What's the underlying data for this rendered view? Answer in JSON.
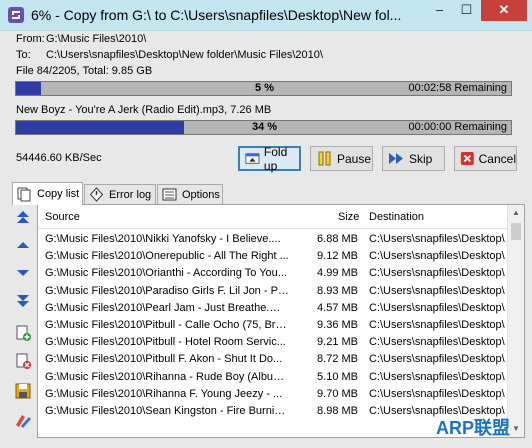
{
  "window": {
    "title": "6% - Copy from G:\\ to C:\\Users\\snapfiles\\Desktop\\New fol...",
    "controls": {
      "minimize": "–",
      "maximize": "☐",
      "close": "✕"
    }
  },
  "info": {
    "from_label": "From:",
    "from_value": "G:\\Music Files\\2010\\",
    "to_label": "To:",
    "to_value": "C:\\Users\\snapfiles\\Desktop\\New folder\\Music Files\\2010\\",
    "file_count": "File 84/2205, Total: 9.85 GB"
  },
  "overall_progress": {
    "fraction": 0.05,
    "percent_label": "5 %",
    "remaining": "00:02:58 Remaining"
  },
  "current_file": "New Boyz - You're A Jerk (Radio Edit).mp3, 7.26 MB",
  "file_progress": {
    "fraction": 0.34,
    "percent_label": "34 %",
    "remaining": "00:00:00 Remaining"
  },
  "speed": "54446.60 KB/Sec",
  "buttons": {
    "fold_up": "Fold up",
    "pause": "Pause",
    "skip": "Skip",
    "cancel": "Cancel"
  },
  "tabs": {
    "copy_list": "Copy list",
    "error_log": "Error log",
    "options": "Options"
  },
  "columns": {
    "source": "Source",
    "size": "Size",
    "destination": "Destination"
  },
  "rows": [
    {
      "source": "G:\\Music Files\\2010\\Nikki Yanofsky - I Believe....",
      "size": "6.88 MB",
      "dest": "C:\\Users\\snapfiles\\Desktop\\"
    },
    {
      "source": "G:\\Music Files\\2010\\Onerepublic - All The Right ...",
      "size": "9.12 MB",
      "dest": "C:\\Users\\snapfiles\\Desktop\\"
    },
    {
      "source": "G:\\Music Files\\2010\\Orianthi - According To You...",
      "size": "4.99 MB",
      "dest": "C:\\Users\\snapfiles\\Desktop\\"
    },
    {
      "source": "G:\\Music Files\\2010\\Paradiso Girls F. Lil Jon - Pa...",
      "size": "8.93 MB",
      "dest": "C:\\Users\\snapfiles\\Desktop\\"
    },
    {
      "source": "G:\\Music Files\\2010\\Pearl Jam - Just Breathe.mp3",
      "size": "4.57 MB",
      "dest": "C:\\Users\\snapfiles\\Desktop\\"
    },
    {
      "source": "G:\\Music Files\\2010\\Pitbull - Calle Ocho (75, Bra...",
      "size": "9.36 MB",
      "dest": "C:\\Users\\snapfiles\\Desktop\\"
    },
    {
      "source": "G:\\Music Files\\2010\\Pitbull - Hotel Room Servic...",
      "size": "9.21 MB",
      "dest": "C:\\Users\\snapfiles\\Desktop\\"
    },
    {
      "source": "G:\\Music Files\\2010\\Pitbull F. Akon - Shut It Do...",
      "size": "8.72 MB",
      "dest": "C:\\Users\\snapfiles\\Desktop\\"
    },
    {
      "source": "G:\\Music Files\\2010\\Rihanna - Rude Boy (Album...",
      "size": "5.10 MB",
      "dest": "C:\\Users\\snapfiles\\Desktop\\"
    },
    {
      "source": "G:\\Music Files\\2010\\Rihanna F. Young Jeezy - ...",
      "size": "9.70 MB",
      "dest": "C:\\Users\\snapfiles\\Desktop\\"
    },
    {
      "source": "G:\\Music Files\\2010\\Sean Kingston - Fire Burnin...",
      "size": "8.98 MB",
      "dest": "C:\\Users\\snapfiles\\Desktop\\"
    }
  ],
  "watermark": "ARP联盟",
  "colors": {
    "progress_fill": "#2f3ca3",
    "progress_track": "#b5b5b5",
    "titlebar": "#c2e5f0",
    "close": "#c7403a"
  }
}
